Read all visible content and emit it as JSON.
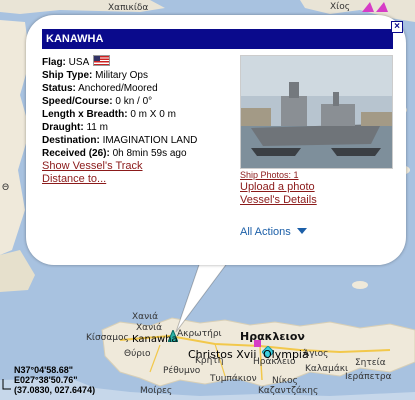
{
  "map": {
    "place_labels": {
      "hania_gr": "Χανιά",
      "hania_grk": "Χανιά",
      "kisamos": "Κίσσαμος",
      "heraklion": "Ηρακλειον",
      "heraklion2": "Ηράκλειο",
      "rethymno": "Ρέθυμνο",
      "thyrio": "Θύριο",
      "akrotiri": "Ακρωτήρι",
      "sitia": "Σητεία",
      "agios": "Άγιος",
      "nikos": "Νίκος",
      "mires": "Μοίρες",
      "ierapetra": "Ιεράπετρα",
      "kaliviani": "Καλαμάκι",
      "tympaki": "Τυμπάκιον",
      "kazantzakis": "Καζαντζάκης",
      "kriti": "Κρήτη",
      "xapikida": "Χαπικίδα",
      "xios": "Χίος",
      "top_partial": "Θ"
    },
    "vessel_labels": {
      "kanawha": "Kanawha",
      "christos": "Christos Xvii",
      "olympia": "Olympia"
    },
    "coords": {
      "lat": "N37°04'58.68\"",
      "lon": "E027°38'50.76\"",
      "decimal": "(37.0830, 027.6474)"
    }
  },
  "popup": {
    "title": "KANAWHA",
    "close_glyph": "×",
    "fields": {
      "flag_label": "Flag:",
      "flag_value": "USA",
      "ship_type_label": "Ship Type:",
      "ship_type_value": "Military Ops",
      "status_label": "Status:",
      "status_value": "Anchored/Moored",
      "speed_label": "Speed/Course:",
      "speed_value": "0 kn / 0°",
      "size_label": "Length x Breadth:",
      "size_value": "0 m X 0 m",
      "draught_label": "Draught:",
      "draught_value": "11 m",
      "destination_label": "Destination:",
      "destination_value": "IMAGINATION LAND",
      "received_label": "Received (26):",
      "received_value": "0h 8min 59s ago"
    },
    "links": {
      "track": "Show Vessel's Track",
      "distance": "Distance to...",
      "photos": "Ship Photos: 1",
      "upload": "Upload a photo",
      "details": "Vessel's Details",
      "actions": "All Actions"
    }
  },
  "colors": {
    "title_bar": "#0a0a8c",
    "link": "#8b1a1a",
    "actions": "#1c5fa8",
    "sea": "#a8c2e0"
  }
}
